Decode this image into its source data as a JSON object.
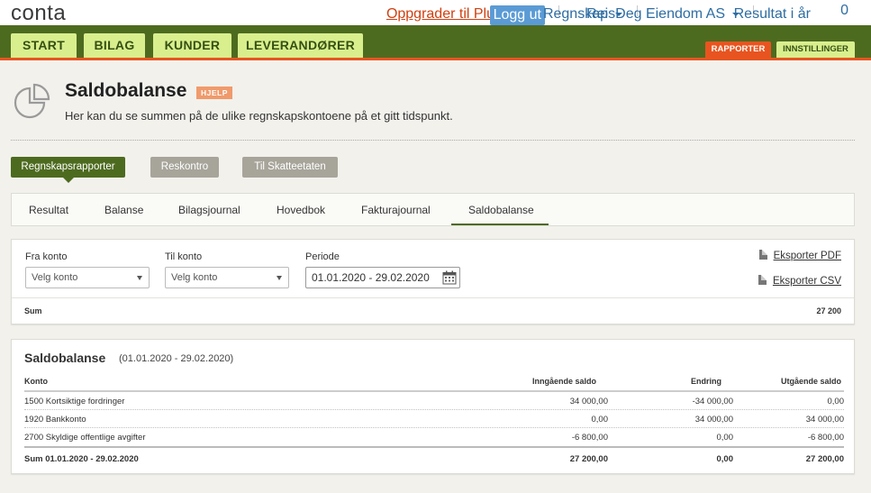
{
  "app": {
    "logo": "conta",
    "upgrade_label": "Oppgrader til Pluss",
    "logout_label": "Logg ut",
    "regnskap_label": "Regnskap",
    "company_label": "ReisDeg Eiendom AS",
    "result_label": "Resultat i år",
    "result_value": "0"
  },
  "nav": {
    "tabs": [
      "START",
      "BILAG",
      "KUNDER",
      "LEVERANDØRER"
    ],
    "rapporter_label": "RAPPORTER",
    "innstillinger_label": "INNSTILLINGER"
  },
  "page": {
    "title": "Saldobalanse",
    "help_label": "HJELP",
    "description": "Her kan du se summen på de ulike regnskapskontoene på et gitt tidspunkt."
  },
  "report_buttons": [
    "Regnskapsrapporter",
    "Reskontro",
    "Til Skatteetaten"
  ],
  "subtabs": [
    "Resultat",
    "Balanse",
    "Bilagsjournal",
    "Hovedbok",
    "Fakturajournal",
    "Saldobalanse"
  ],
  "filter": {
    "fra_label": "Fra konto",
    "fra_placeholder": "Velg konto",
    "til_label": "Til konto",
    "til_placeholder": "Velg konto",
    "periode_label": "Periode",
    "periode_value": "01.01.2020 - 29.02.2020",
    "export_pdf": "Eksporter PDF",
    "export_csv": "Eksporter CSV",
    "sum_label": "Sum",
    "sum_value": "27 200"
  },
  "balance": {
    "title": "Saldobalanse",
    "period": "(01.01.2020 - 29.02.2020)",
    "headers": {
      "konto": "Konto",
      "inngaende": "Inngående saldo",
      "endring": "Endring",
      "utgaende": "Utgående saldo"
    },
    "rows": [
      {
        "konto": "1500 Kortsiktige fordringer",
        "inngaende": "34 000,00",
        "endring": "-34 000,00",
        "utgaende": "0,00"
      },
      {
        "konto": "1920 Bankkonto",
        "inngaende": "0,00",
        "endring": "34 000,00",
        "utgaende": "34 000,00"
      },
      {
        "konto": "2700 Skyldige offentlige avgifter",
        "inngaende": "-6 800,00",
        "endring": "0,00",
        "utgaende": "-6 800,00"
      }
    ],
    "total": {
      "label": "Sum 01.01.2020 - 29.02.2020",
      "inngaende": "27 200,00",
      "endring": "0,00",
      "utgaende": "27 200,00"
    }
  },
  "colors": {
    "nav_green": "#4d6b1f",
    "tab_lime": "#d9ef8e",
    "accent_orange": "#e8541f",
    "link_blue": "#2d6da3"
  }
}
